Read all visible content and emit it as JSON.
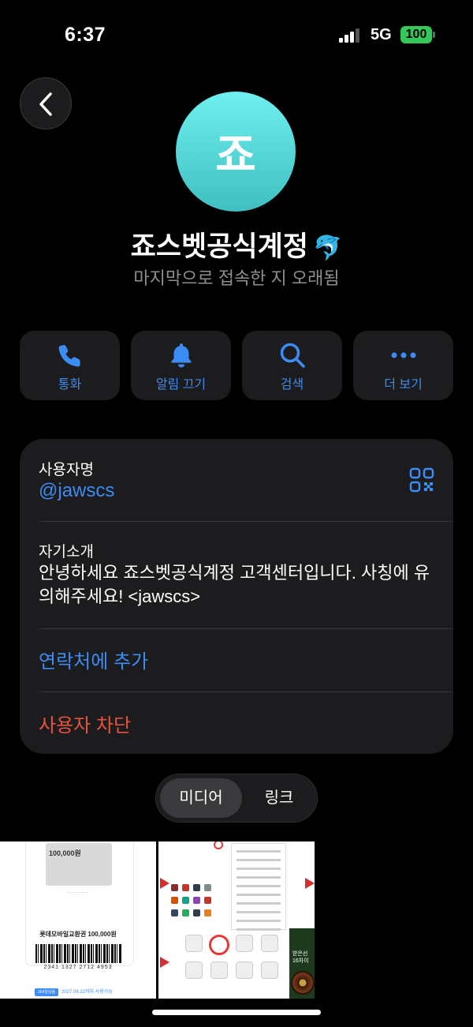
{
  "status_bar": {
    "time": "6:37",
    "network": "5G",
    "battery": "100"
  },
  "profile": {
    "avatar_initial": "죠",
    "avatar_color": "#5fdcdc",
    "name": "죠스벳공식계정",
    "name_emoji": "🐬",
    "last_seen": "마지막으로 접속한 지 오래됨"
  },
  "actions": [
    {
      "label": "통화",
      "icon": "phone-icon"
    },
    {
      "label": "알림 끄기",
      "icon": "bell-icon"
    },
    {
      "label": "검색",
      "icon": "search-icon"
    },
    {
      "label": "더 보기",
      "icon": "more-icon"
    }
  ],
  "info": {
    "username_label": "사용자명",
    "username": "@jawscs",
    "bio_label": "자기소개",
    "bio": "안녕하세요 죠스벳공식계정 고객센터입니다. 사칭에 유의해주세요! <jawscs>",
    "add_contact": "연락처에 추가",
    "block_user": "사용자 차단"
  },
  "tabs": {
    "media": "미디어",
    "links": "링크"
  },
  "media": {
    "thumb1": {
      "amount": "100,000원",
      "title": "롯데모바일교환권 100,000원",
      "barcode_number": "2341 1327 2712 4953",
      "badge": "364일남음",
      "expiry": "2027.06.22까지 사용가능"
    },
    "thumb2": {
      "side_text": "받은선\n16차이"
    }
  },
  "colors": {
    "accent": "#3b8cf3",
    "danger": "#e5533c",
    "card": "#1c1c1e"
  }
}
